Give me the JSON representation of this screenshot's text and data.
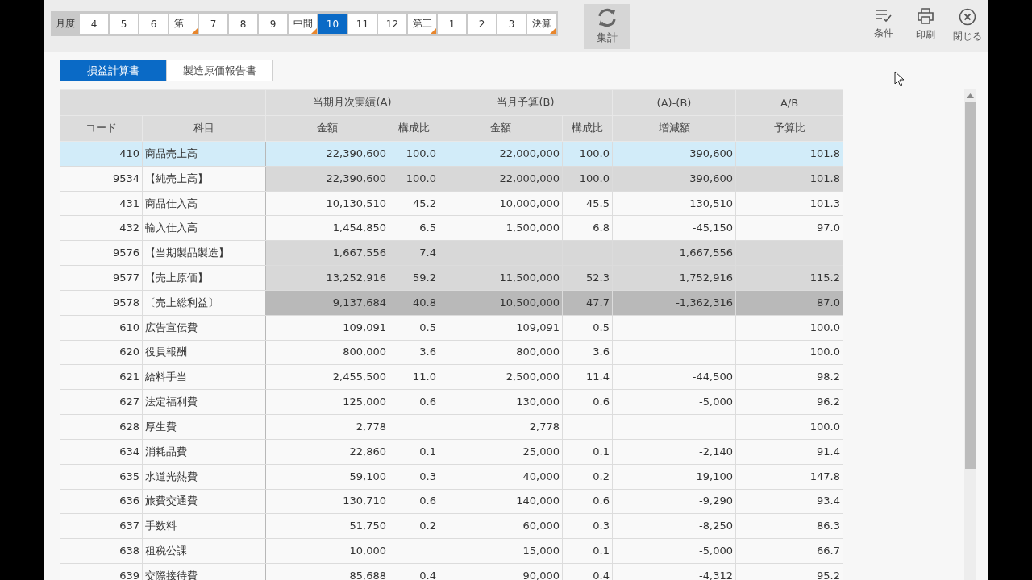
{
  "period_bar": {
    "label": "月度",
    "periods": [
      {
        "label": "4",
        "selected": false,
        "flagged": false
      },
      {
        "label": "5",
        "selected": false,
        "flagged": false
      },
      {
        "label": "6",
        "selected": false,
        "flagged": false
      },
      {
        "label": "第一",
        "selected": false,
        "flagged": true
      },
      {
        "label": "7",
        "selected": false,
        "flagged": false
      },
      {
        "label": "8",
        "selected": false,
        "flagged": false
      },
      {
        "label": "9",
        "selected": false,
        "flagged": false
      },
      {
        "label": "中間",
        "selected": false,
        "flagged": true
      },
      {
        "label": "10",
        "selected": true,
        "flagged": false
      },
      {
        "label": "11",
        "selected": false,
        "flagged": false
      },
      {
        "label": "12",
        "selected": false,
        "flagged": false
      },
      {
        "label": "第三",
        "selected": false,
        "flagged": true
      },
      {
        "label": "1",
        "selected": false,
        "flagged": false
      },
      {
        "label": "2",
        "selected": false,
        "flagged": false
      },
      {
        "label": "3",
        "selected": false,
        "flagged": false
      },
      {
        "label": "決算",
        "selected": false,
        "flagged": true
      }
    ]
  },
  "aggregate_button": "集計",
  "toolbar": [
    {
      "kind": "conditions",
      "label": "条件"
    },
    {
      "kind": "print",
      "label": "印刷"
    },
    {
      "kind": "close",
      "label": "閉じる"
    }
  ],
  "tabs": [
    {
      "label": "損益計算書",
      "selected": true
    },
    {
      "label": "製造原価報告書",
      "selected": false
    }
  ],
  "table": {
    "key_columns": [
      "コード",
      "科目"
    ],
    "groups": [
      {
        "label": "当期月次実績(A)",
        "columns": [
          "金額",
          "構成比"
        ]
      },
      {
        "label": "当月予算(B)",
        "columns": [
          "金額",
          "構成比"
        ]
      },
      {
        "label": "(A)-(B)",
        "columns": [
          "増減額"
        ]
      },
      {
        "label": "A/B",
        "columns": [
          "予算比"
        ]
      }
    ],
    "rows": [
      {
        "kind": "normal",
        "selected": true,
        "cells": [
          "410",
          "商品売上高",
          "22,390,600",
          "100.0",
          "22,000,000",
          "100.0",
          "390,600",
          "101.8"
        ]
      },
      {
        "kind": "subtotal",
        "selected": false,
        "cells": [
          "9534",
          "【純売上高】",
          "22,390,600",
          "100.0",
          "22,000,000",
          "100.0",
          "390,600",
          "101.8"
        ]
      },
      {
        "kind": "normal",
        "selected": false,
        "cells": [
          "431",
          "商品仕入高",
          "10,130,510",
          "45.2",
          "10,000,000",
          "45.5",
          "130,510",
          "101.3"
        ]
      },
      {
        "kind": "normal",
        "selected": false,
        "cells": [
          "432",
          "輸入仕入高",
          "1,454,850",
          "6.5",
          "1,500,000",
          "6.8",
          "-45,150",
          "97.0"
        ]
      },
      {
        "kind": "subtotal",
        "selected": false,
        "cells": [
          "9576",
          "【当期製品製造】",
          "1,667,556",
          "7.4",
          "",
          "",
          "1,667,556",
          ""
        ]
      },
      {
        "kind": "subtotal",
        "selected": false,
        "cells": [
          "9577",
          "【売上原価】",
          "13,252,916",
          "59.2",
          "11,500,000",
          "52.3",
          "1,752,916",
          "115.2"
        ]
      },
      {
        "kind": "total",
        "selected": false,
        "cells": [
          "9578",
          "〔売上総利益〕",
          "9,137,684",
          "40.8",
          "10,500,000",
          "47.7",
          "-1,362,316",
          "87.0"
        ]
      },
      {
        "kind": "normal",
        "selected": false,
        "cells": [
          "610",
          "広告宣伝費",
          "109,091",
          "0.5",
          "109,091",
          "0.5",
          "",
          "100.0"
        ]
      },
      {
        "kind": "normal",
        "selected": false,
        "cells": [
          "620",
          "役員報酬",
          "800,000",
          "3.6",
          "800,000",
          "3.6",
          "",
          "100.0"
        ]
      },
      {
        "kind": "normal",
        "selected": false,
        "cells": [
          "621",
          "給料手当",
          "2,455,500",
          "11.0",
          "2,500,000",
          "11.4",
          "-44,500",
          "98.2"
        ]
      },
      {
        "kind": "normal",
        "selected": false,
        "cells": [
          "627",
          "法定福利費",
          "125,000",
          "0.6",
          "130,000",
          "0.6",
          "-5,000",
          "96.2"
        ]
      },
      {
        "kind": "normal",
        "selected": false,
        "cells": [
          "628",
          "厚生費",
          "2,778",
          "",
          "2,778",
          "",
          "",
          "100.0"
        ]
      },
      {
        "kind": "normal",
        "selected": false,
        "cells": [
          "634",
          "消耗品費",
          "22,860",
          "0.1",
          "25,000",
          "0.1",
          "-2,140",
          "91.4"
        ]
      },
      {
        "kind": "normal",
        "selected": false,
        "cells": [
          "635",
          "水道光熱費",
          "59,100",
          "0.3",
          "40,000",
          "0.2",
          "19,100",
          "147.8"
        ]
      },
      {
        "kind": "normal",
        "selected": false,
        "cells": [
          "636",
          "旅費交通費",
          "130,710",
          "0.6",
          "140,000",
          "0.6",
          "-9,290",
          "93.4"
        ]
      },
      {
        "kind": "normal",
        "selected": false,
        "cells": [
          "637",
          "手数料",
          "51,750",
          "0.2",
          "60,000",
          "0.3",
          "-8,250",
          "86.3"
        ]
      },
      {
        "kind": "normal",
        "selected": false,
        "cells": [
          "638",
          "租税公課",
          "10,000",
          "",
          "15,000",
          "0.1",
          "-5,000",
          "66.7"
        ]
      },
      {
        "kind": "normal",
        "selected": false,
        "cells": [
          "639",
          "交際接待費",
          "85,688",
          "0.4",
          "90,000",
          "0.4",
          "-4,312",
          "95.2"
        ]
      }
    ]
  }
}
